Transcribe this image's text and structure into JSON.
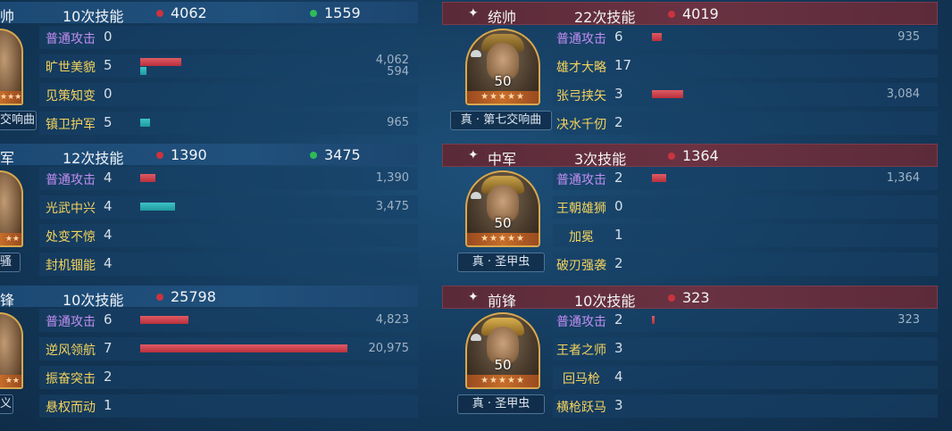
{
  "left": {
    "groups": [
      {
        "role": "帅",
        "skill_count": "10次技能",
        "damage": "4062",
        "heal": "1559",
        "name_tag": "交响曲",
        "skills": [
          {
            "name": "普通攻击",
            "count": "0",
            "values": [],
            "basic": true
          },
          {
            "name": "旷世美貌",
            "count": "5",
            "values": [
              "4,062",
              "594"
            ],
            "basic": false
          },
          {
            "name": "见策知变",
            "count": "0",
            "values": [],
            "basic": false
          },
          {
            "name": "镇卫护军",
            "count": "5",
            "values": [
              "965"
            ],
            "basic": false
          }
        ]
      },
      {
        "role": "军",
        "skill_count": "12次技能",
        "damage": "1390",
        "heal": "3475",
        "name_tag": "骚",
        "skills": [
          {
            "name": "普通攻击",
            "count": "4",
            "values": [
              "1,390"
            ],
            "basic": true
          },
          {
            "name": "光武中兴",
            "count": "4",
            "values": [
              "3,475"
            ],
            "basic": false
          },
          {
            "name": "处变不惊",
            "count": "4",
            "values": [],
            "basic": false
          },
          {
            "name": "封机锢能",
            "count": "4",
            "values": [],
            "basic": false
          }
        ]
      },
      {
        "role": "锋",
        "skill_count": "10次技能",
        "damage": "25798",
        "name_tag": "义",
        "skills": [
          {
            "name": "普通攻击",
            "count": "6",
            "values": [
              "4,823"
            ],
            "basic": true
          },
          {
            "name": "逆风领航",
            "count": "7",
            "values": [
              "20,975"
            ],
            "basic": false
          },
          {
            "name": "振奋突击",
            "count": "2",
            "values": [],
            "basic": false
          },
          {
            "name": "悬权而动",
            "count": "1",
            "values": [],
            "basic": false
          }
        ]
      }
    ]
  },
  "right": {
    "groups": [
      {
        "role": "统帅",
        "skill_count": "22次技能",
        "damage": "4019",
        "level": "50",
        "stars": "★★★★★",
        "name_tag": "真 · 第七交响曲",
        "skills": [
          {
            "name": "普通攻击",
            "count": "6",
            "values": [
              "935"
            ],
            "basic": true
          },
          {
            "name": "雄才大略",
            "count": "17",
            "values": [],
            "basic": false
          },
          {
            "name": "张弓挟矢",
            "count": "3",
            "values": [
              "3,084"
            ],
            "basic": false
          },
          {
            "name": "决水千仞",
            "count": "2",
            "values": [],
            "basic": false
          }
        ]
      },
      {
        "role": "中军",
        "skill_count": "3次技能",
        "damage": "1364",
        "level": "50",
        "stars": "★★★★★",
        "name_tag": "真 · 圣甲虫",
        "skills": [
          {
            "name": "普通攻击",
            "count": "2",
            "values": [
              "1,364"
            ],
            "basic": true
          },
          {
            "name": "王朝雄狮",
            "count": "0",
            "values": [],
            "basic": false
          },
          {
            "name": "加冕",
            "count": "1",
            "values": [],
            "basic": false
          },
          {
            "name": "破刃强袭",
            "count": "2",
            "values": [],
            "basic": false
          }
        ]
      },
      {
        "role": "前锋",
        "skill_count": "10次技能",
        "damage": "323",
        "level": "50",
        "stars": "★★★★★",
        "name_tag": "真 · 圣甲虫",
        "skills": [
          {
            "name": "普通攻击",
            "count": "2",
            "values": [
              "323"
            ],
            "basic": true
          },
          {
            "name": "王者之师",
            "count": "3",
            "values": [],
            "basic": false
          },
          {
            "name": "回马枪",
            "count": "4",
            "values": [],
            "basic": false
          },
          {
            "name": "横枪跃马",
            "count": "3",
            "values": [],
            "basic": false
          }
        ]
      }
    ]
  },
  "header_symbol": "✦",
  "colors": {
    "damage": "#c9343f",
    "heal": "#2fbb58",
    "skill_basic": "#c28ef2",
    "skill": "#f4d35c"
  }
}
